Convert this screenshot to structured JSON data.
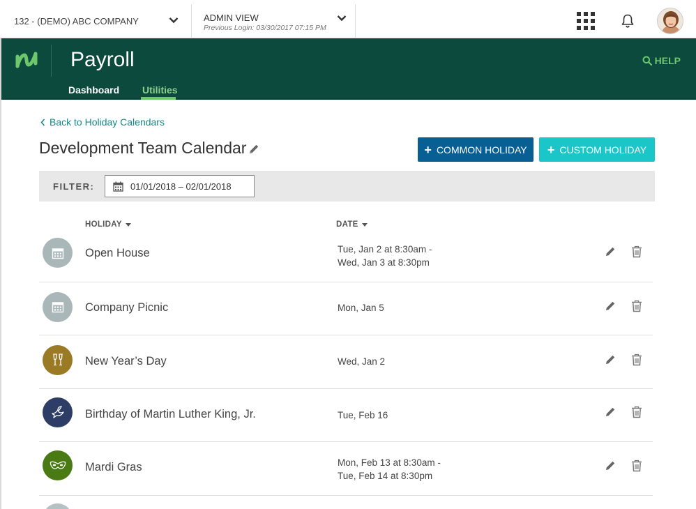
{
  "topbar": {
    "company": "132 - (DEMO) ABC COMPANY",
    "admin_view": "ADMIN VIEW",
    "previous_login": "Previous Login: 03/30/2017 07:15 PM"
  },
  "header": {
    "app_title": "Payroll",
    "help_label": "HELP",
    "tabs": [
      {
        "label": "Dashboard",
        "active": false
      },
      {
        "label": "Utilities",
        "active": true
      }
    ]
  },
  "main": {
    "back_link": "Back to Holiday Calendars",
    "page_title": "Development Team Calendar",
    "common_holiday_button": "COMMON HOLIDAY",
    "custom_holiday_button": "CUSTOM HOLIDAY",
    "filter_label": "FILTER:",
    "date_range": "01/01/2018 – 02/01/2018",
    "columns": {
      "holiday": "HOLIDAY",
      "date": "DATE"
    },
    "rows": [
      {
        "name": "Open House",
        "date_line1": "Tue, Jan 2 at 8:30am -",
        "date_line2": "Wed, Jan 3 at 8:30pm",
        "icon": "calendar-icon",
        "color": "#a9b7b9"
      },
      {
        "name": "Company Picnic",
        "date_line1": "Mon, Jan 5",
        "date_line2": "",
        "icon": "calendar-icon",
        "color": "#a9b7b9"
      },
      {
        "name": "New Year’s Day",
        "date_line1": "Wed, Jan 2",
        "date_line2": "",
        "icon": "champagne-icon",
        "color": "#9b7a26"
      },
      {
        "name": "Birthday of Martin Luther King, Jr.",
        "date_line1": "Tue, Feb 16",
        "date_line2": "",
        "icon": "dove-icon",
        "color": "#2e3d66"
      },
      {
        "name": "Mardi Gras",
        "date_line1": "Mon, Feb 13 at 8:30am -",
        "date_line2": "Tue, Feb 14 at 8:30pm",
        "icon": "mask-icon",
        "color": "#4a7a14"
      }
    ]
  },
  "colors": {
    "header_green": "#0b4a3d",
    "accent_green": "#6ec76b",
    "common_button": "#075f93",
    "custom_button": "#1bc6c9",
    "link_teal": "#108a8a"
  }
}
